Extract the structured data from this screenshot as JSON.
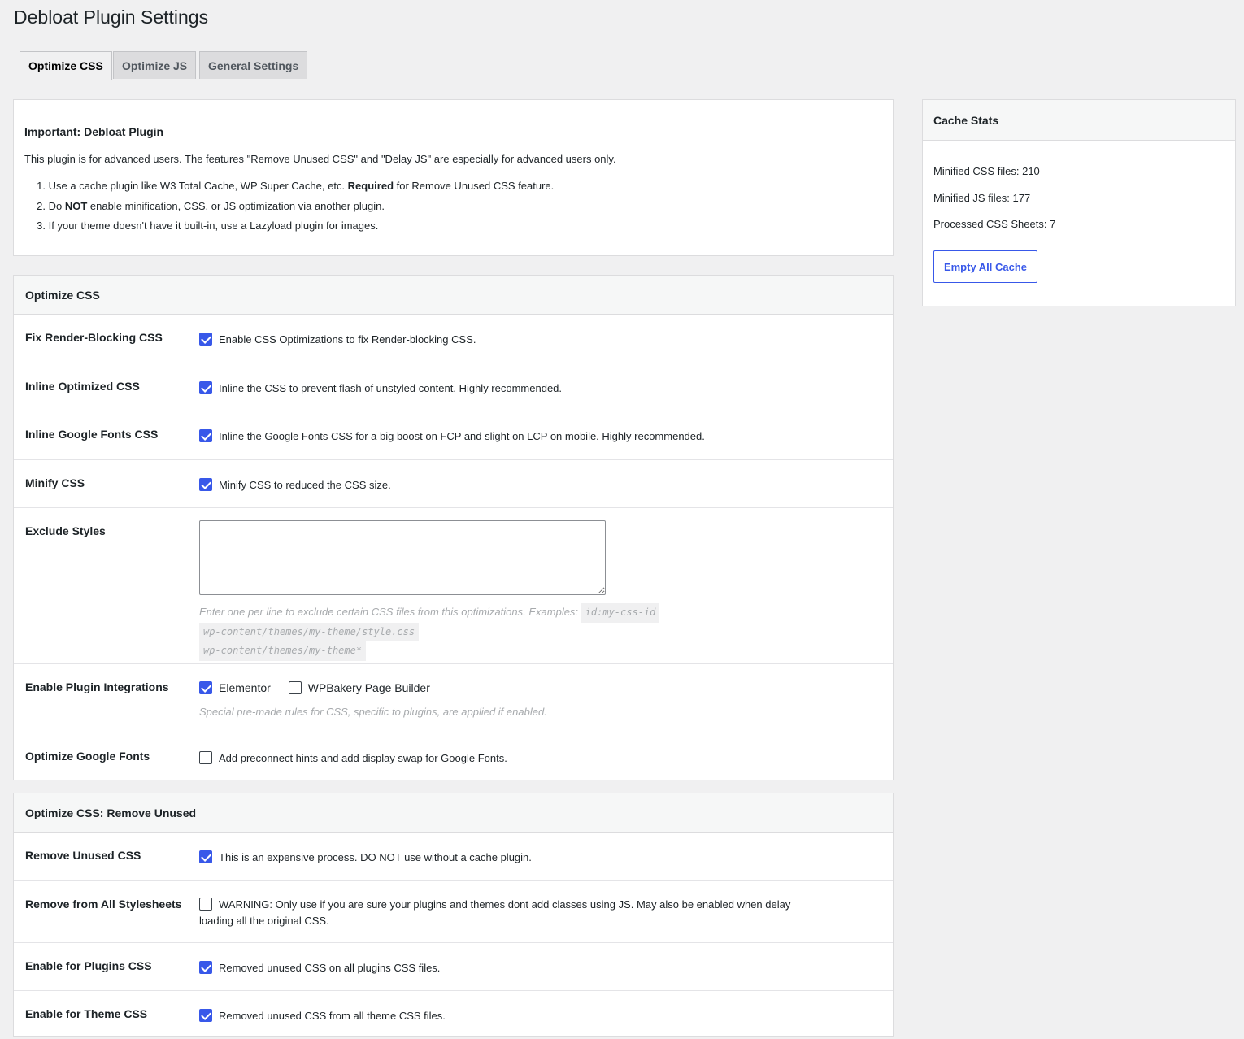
{
  "page_title": "Debloat Plugin Settings",
  "tabs": [
    {
      "label": "Optimize CSS",
      "active": true
    },
    {
      "label": "Optimize JS",
      "active": false
    },
    {
      "label": "General Settings",
      "active": false
    }
  ],
  "notice": {
    "title": "Important: Debloat Plugin",
    "text": "This plugin is for advanced users. The features \"Remove Unused CSS\" and \"Delay JS\" are especially for advanced users only.",
    "items": [
      {
        "num": "1.",
        "pre": "Use a cache plugin like W3 Total Cache, WP Super Cache, etc. ",
        "bold": "Required",
        "post": " for Remove Unused CSS feature."
      },
      {
        "num": "2.",
        "pre": "Do ",
        "bold": "NOT",
        "post": " enable minification, CSS, or JS optimization via another plugin."
      },
      {
        "num": "3.",
        "pre": "If your theme doesn't have it built-in, use a Lazyload plugin for images.",
        "bold": "",
        "post": ""
      }
    ]
  },
  "cache_stats": {
    "title": "Cache Stats",
    "minified_css": "Minified CSS files: 210",
    "minified_js": "Minified JS files: 177",
    "processed_css": "Processed CSS Sheets: 7",
    "button": "Empty All Cache"
  },
  "optimize_css": {
    "heading": "Optimize CSS",
    "fix_render": {
      "label": "Fix Render-Blocking CSS",
      "checked": true,
      "text": "Enable CSS Optimizations to fix Render-blocking CSS."
    },
    "inline_optimized": {
      "label": "Inline Optimized CSS",
      "checked": true,
      "text": "Inline the CSS to prevent flash of unstyled content. Highly recommended."
    },
    "inline_fonts": {
      "label": "Inline Google Fonts CSS",
      "checked": true,
      "text": "Inline the Google Fonts CSS for a big boost on FCP and slight on LCP on mobile. Highly recommended."
    },
    "minify": {
      "label": "Minify CSS",
      "checked": true,
      "text": "Minify CSS to reduced the CSS size."
    },
    "exclude": {
      "label": "Exclude Styles",
      "value": "",
      "desc": "Enter one per line to exclude certain CSS files from this optimizations. Examples: ",
      "examples": [
        "id:my-css-id",
        "wp-content/themes/my-theme/style.css",
        "wp-content/themes/my-theme*"
      ]
    },
    "integrations": {
      "label": "Enable Plugin Integrations",
      "elementor": {
        "label": "Elementor",
        "checked": true
      },
      "wpbakery": {
        "label": "WPBakery Page Builder",
        "checked": false
      },
      "desc": "Special pre-made rules for CSS, specific to plugins, are applied if enabled."
    },
    "google_fonts": {
      "label": "Optimize Google Fonts",
      "checked": false,
      "text": "Add preconnect hints and add display swap for Google Fonts."
    }
  },
  "remove_unused": {
    "heading": "Optimize CSS: Remove Unused",
    "remove_unused": {
      "label": "Remove Unused CSS",
      "checked": true,
      "text": "This is an expensive process. DO NOT use without a cache plugin."
    },
    "all_sheets": {
      "label": "Remove from All Stylesheets",
      "checked": false,
      "text": "WARNING: Only use if you are sure your plugins and themes dont add classes using JS. May also be enabled when delay loading all the original CSS."
    },
    "plugins_css": {
      "label": "Enable for Plugins CSS",
      "checked": true,
      "text": "Removed unused CSS on all plugins CSS files."
    },
    "theme_css": {
      "label": "Enable for Theme CSS",
      "checked": true,
      "text": "Removed unused CSS from all theme CSS files."
    }
  },
  "colors": {
    "accent": "#3858e9",
    "background": "#f0f0f1",
    "panel": "#ffffff"
  },
  "icons": {
    "checkbox_checked": "checkmark-icon"
  }
}
